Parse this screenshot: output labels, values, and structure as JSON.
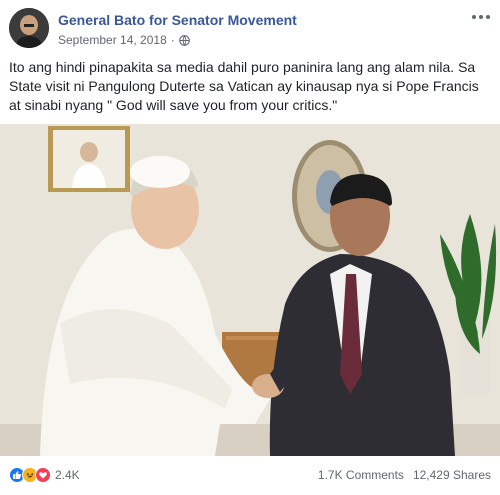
{
  "post": {
    "page_name": "General Bato for Senator Movement",
    "date": "September 14, 2018",
    "separator": "·",
    "text": "Ito ang hindi pinapakita sa media dahil puro paninira lang ang alam nila. Sa State visit ni Pangulong Duterte sa Vatican ay kinausap nya si Pope Francis at sinabi nyang \" God will save you from your critics.\"",
    "privacy_icon": "globe-icon",
    "menu_icon": "more-icon",
    "photo_description_icon": "photo"
  },
  "stats": {
    "reactions_count": "2.4K",
    "reaction_types": [
      "like-icon",
      "haha-icon",
      "love-icon"
    ],
    "comments": "1.7K Comments",
    "shares": "12,429 Shares"
  },
  "colors": {
    "link": "#385898",
    "secondary_text": "#616770",
    "like_blue": "#1877f2",
    "love_red": "#f33e58",
    "haha_yellow": "#f7b125"
  }
}
